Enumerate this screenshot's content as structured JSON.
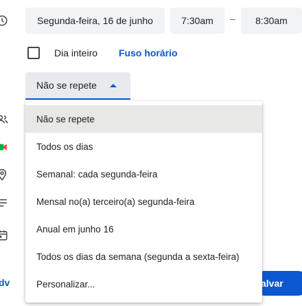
{
  "event": {
    "date": "Segunda-feira, 16 de junho",
    "start_time": "7:30am",
    "separator": "–",
    "end_time": "8:30am"
  },
  "all_day": {
    "label": "Dia inteiro",
    "checked": false
  },
  "timezone_link": "Fuso horário",
  "repeat": {
    "selected": "Não se repete",
    "options": [
      "Não se repete",
      "Todos os dias",
      "Semanal: cada segunda-feira",
      "Mensal no(a) terceiro(a) segunda-feira",
      "Anual em junho 16",
      "Todos os dias da semana (segunda a sexta-feira)",
      "Personalizar..."
    ]
  },
  "footer": {
    "left_link": "dv",
    "save_label": "alvar"
  },
  "icons": [
    "clock-icon",
    "people-icon",
    "meet-icon",
    "location-icon",
    "description-icon",
    "calendar-icon"
  ],
  "colors": {
    "accent": "#0b57d0",
    "field_bg": "#f1f3f4",
    "selected_option_bg": "#e8e9e6"
  }
}
